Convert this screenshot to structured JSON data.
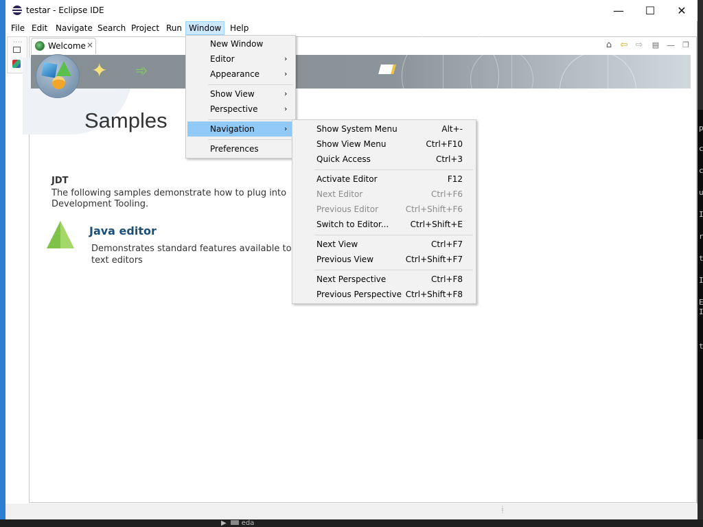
{
  "window": {
    "title": "testar - Eclipse IDE",
    "controls": {
      "minimize": "—",
      "maximize": "☐",
      "close": "✕"
    }
  },
  "menubar": {
    "items": [
      {
        "label": "File"
      },
      {
        "label": "Edit"
      },
      {
        "label": "Navigate"
      },
      {
        "label": "Search"
      },
      {
        "label": "Project"
      },
      {
        "label": "Run"
      },
      {
        "label": "Window"
      },
      {
        "label": "Help"
      }
    ]
  },
  "tab": {
    "label": "Welcome",
    "close": "✕"
  },
  "welcome": {
    "heading": "Samples",
    "section_title": "JDT",
    "section_desc": "The following samples demonstrate how to plug into Development Tooling.",
    "sample_link": "Java editor",
    "sample_desc": "Demonstrates standard features available to text editors"
  },
  "window_menu": {
    "items": [
      {
        "label": "New Window",
        "submenu": false
      },
      {
        "label": "Editor",
        "submenu": true
      },
      {
        "label": "Appearance",
        "submenu": true
      },
      {
        "label": "Show View",
        "submenu": true
      },
      {
        "label": "Perspective",
        "submenu": true
      },
      {
        "label": "Navigation",
        "submenu": true,
        "highlighted": true
      },
      {
        "label": "Preferences",
        "submenu": false
      }
    ]
  },
  "navigation_menu": {
    "items": [
      {
        "label": "Show System Menu",
        "shortcut": "Alt+-",
        "enabled": true
      },
      {
        "label": "Show View Menu",
        "shortcut": "Ctrl+F10",
        "enabled": true
      },
      {
        "label": "Quick Access",
        "shortcut": "Ctrl+3",
        "enabled": true
      },
      {
        "label": "Activate Editor",
        "shortcut": "F12",
        "enabled": true
      },
      {
        "label": "Next Editor",
        "shortcut": "Ctrl+F6",
        "enabled": false
      },
      {
        "label": "Previous Editor",
        "shortcut": "Ctrl+Shift+F6",
        "enabled": false
      },
      {
        "label": "Switch to Editor...",
        "shortcut": "Ctrl+Shift+E",
        "enabled": true
      },
      {
        "label": "Next View",
        "shortcut": "Ctrl+F7",
        "enabled": true
      },
      {
        "label": "Previous View",
        "shortcut": "Ctrl+Shift+F7",
        "enabled": true
      },
      {
        "label": "Next Perspective",
        "shortcut": "Ctrl+F8",
        "enabled": true
      },
      {
        "label": "Previous Perspective",
        "shortcut": "Ctrl+Shift+F8",
        "enabled": true
      }
    ]
  },
  "background_terminal": {
    "chars": [
      "p",
      "c",
      "c",
      "u",
      "I",
      "r",
      "t",
      "I",
      "E",
      "I",
      "t"
    ]
  },
  "taskbar": {
    "item_label": "eda"
  },
  "icons": {
    "home": "home-icon",
    "back": "back-arrow-icon",
    "forward": "forward-arrow-icon",
    "tree": "tree-view-icon",
    "minimize_view": "minimize-view-icon",
    "maximize_view": "maximize-view-icon"
  },
  "colors": {
    "menu_highlight": "#91c9f7",
    "active_menu": "#cce8ff",
    "link": "#1a4f7b",
    "desktop": "#2c7fd0"
  }
}
